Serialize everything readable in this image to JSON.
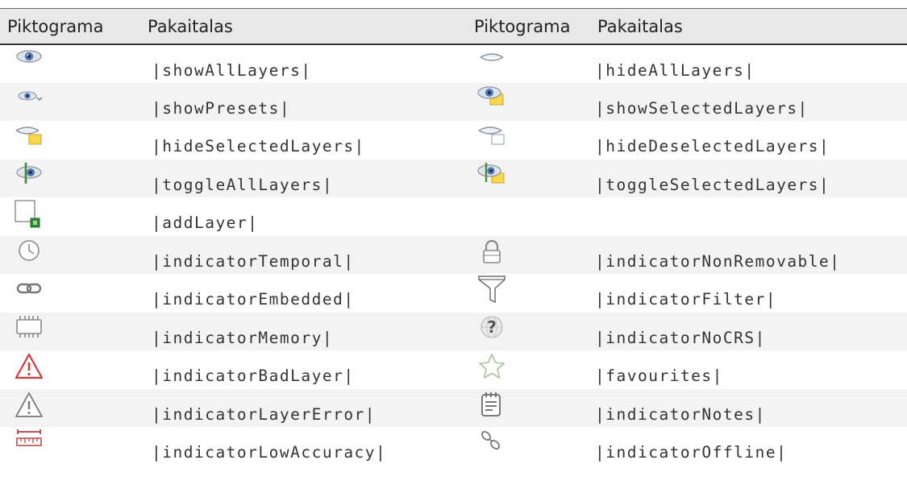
{
  "table": {
    "header": {
      "icon_col": "Piktograma",
      "sub_col": "Pakaitalas",
      "icon_col_2": "Piktograma",
      "sub_col_2": "Pakaitalas"
    },
    "rows": [
      {
        "left": {
          "icon": "eye-icon",
          "text": "|showAllLayers|"
        },
        "right": {
          "icon": "eye-closed-icon",
          "text": "|hideAllLayers|"
        }
      },
      {
        "left": {
          "icon": "eye-presets-icon",
          "text": "|showPresets|"
        },
        "right": {
          "icon": "eye-selected-icon",
          "text": "|showSelectedLayers|"
        }
      },
      {
        "left": {
          "icon": "eye-closed-selected-icon",
          "text": "|hideSelectedLayers|"
        },
        "right": {
          "icon": "eye-closed-deselected-icon",
          "text": "|hideDeselectedLayers|"
        }
      },
      {
        "left": {
          "icon": "eye-toggle-icon",
          "text": "|toggleAllLayers|"
        },
        "right": {
          "icon": "eye-toggle-selected-icon",
          "text": "|toggleSelectedLayers|"
        }
      },
      {
        "left": {
          "icon": "add-layer-icon",
          "text": "|addLayer|"
        },
        "right": {
          "icon": "",
          "text": ""
        }
      },
      {
        "left": {
          "icon": "clock-icon",
          "text": "|indicatorTemporal|"
        },
        "right": {
          "icon": "lock-icon",
          "text": "|indicatorNonRemovable|"
        }
      },
      {
        "left": {
          "icon": "link-icon",
          "text": "|indicatorEmbedded|"
        },
        "right": {
          "icon": "filter-icon",
          "text": "|indicatorFilter|"
        }
      },
      {
        "left": {
          "icon": "memory-chip-icon",
          "text": "|indicatorMemory|"
        },
        "right": {
          "icon": "globe-question-icon",
          "text": "|indicatorNoCRS|"
        }
      },
      {
        "left": {
          "icon": "warning-red-icon",
          "text": "|indicatorBadLayer|"
        },
        "right": {
          "icon": "star-icon",
          "text": "|favourites|"
        }
      },
      {
        "left": {
          "icon": "warning-gray-icon",
          "text": "|indicatorLayerError|"
        },
        "right": {
          "icon": "notes-icon",
          "text": "|indicatorNotes|"
        }
      },
      {
        "left": {
          "icon": "ruler-icon",
          "text": "|indicatorLowAccuracy|"
        },
        "right": {
          "icon": "offline-icon",
          "text": "|indicatorOffline|"
        }
      }
    ]
  }
}
